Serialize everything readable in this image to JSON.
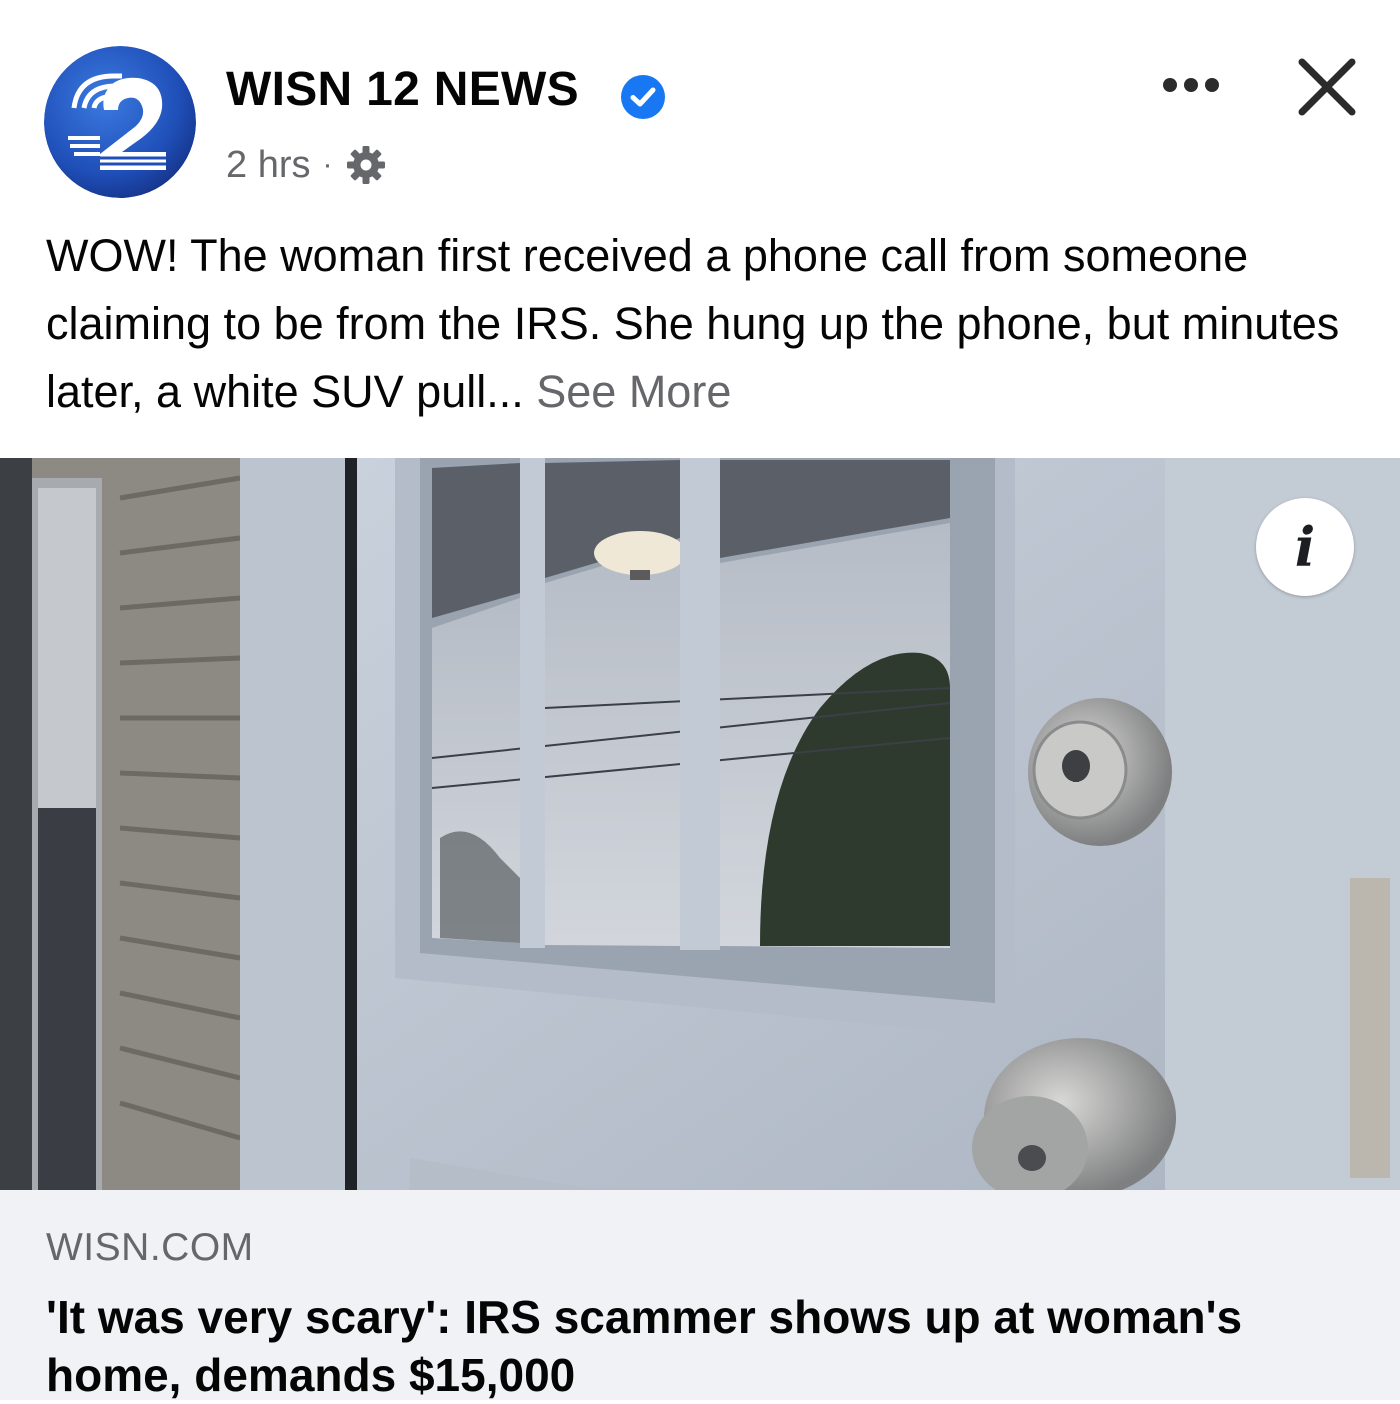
{
  "post": {
    "page_name": "WISN 12 NEWS",
    "verified_icon": "verified-badge-icon",
    "time": "2 hrs",
    "separator": "·",
    "audience_icon": "gear-icon",
    "caption_text": "WOW! The woman first received a phone call from someone claiming to be from the IRS. She hung up the phone, but minutes later, a white SUV pull...",
    "see_more_label": "See More",
    "more_icon": "more-options-icon",
    "close_icon": "close-icon"
  },
  "media": {
    "info_glyph": "i",
    "info_icon": "info-icon"
  },
  "link_preview": {
    "domain": "WISN.COM",
    "title": "'It was very scary': IRS scammer shows up at woman's home, demands $15,000"
  },
  "colors": {
    "text_primary": "#050505",
    "text_secondary": "#65676b",
    "verified_blue": "#1877f2",
    "link_background": "#f0f2f5",
    "logo_blue": "#1f4fb8"
  }
}
